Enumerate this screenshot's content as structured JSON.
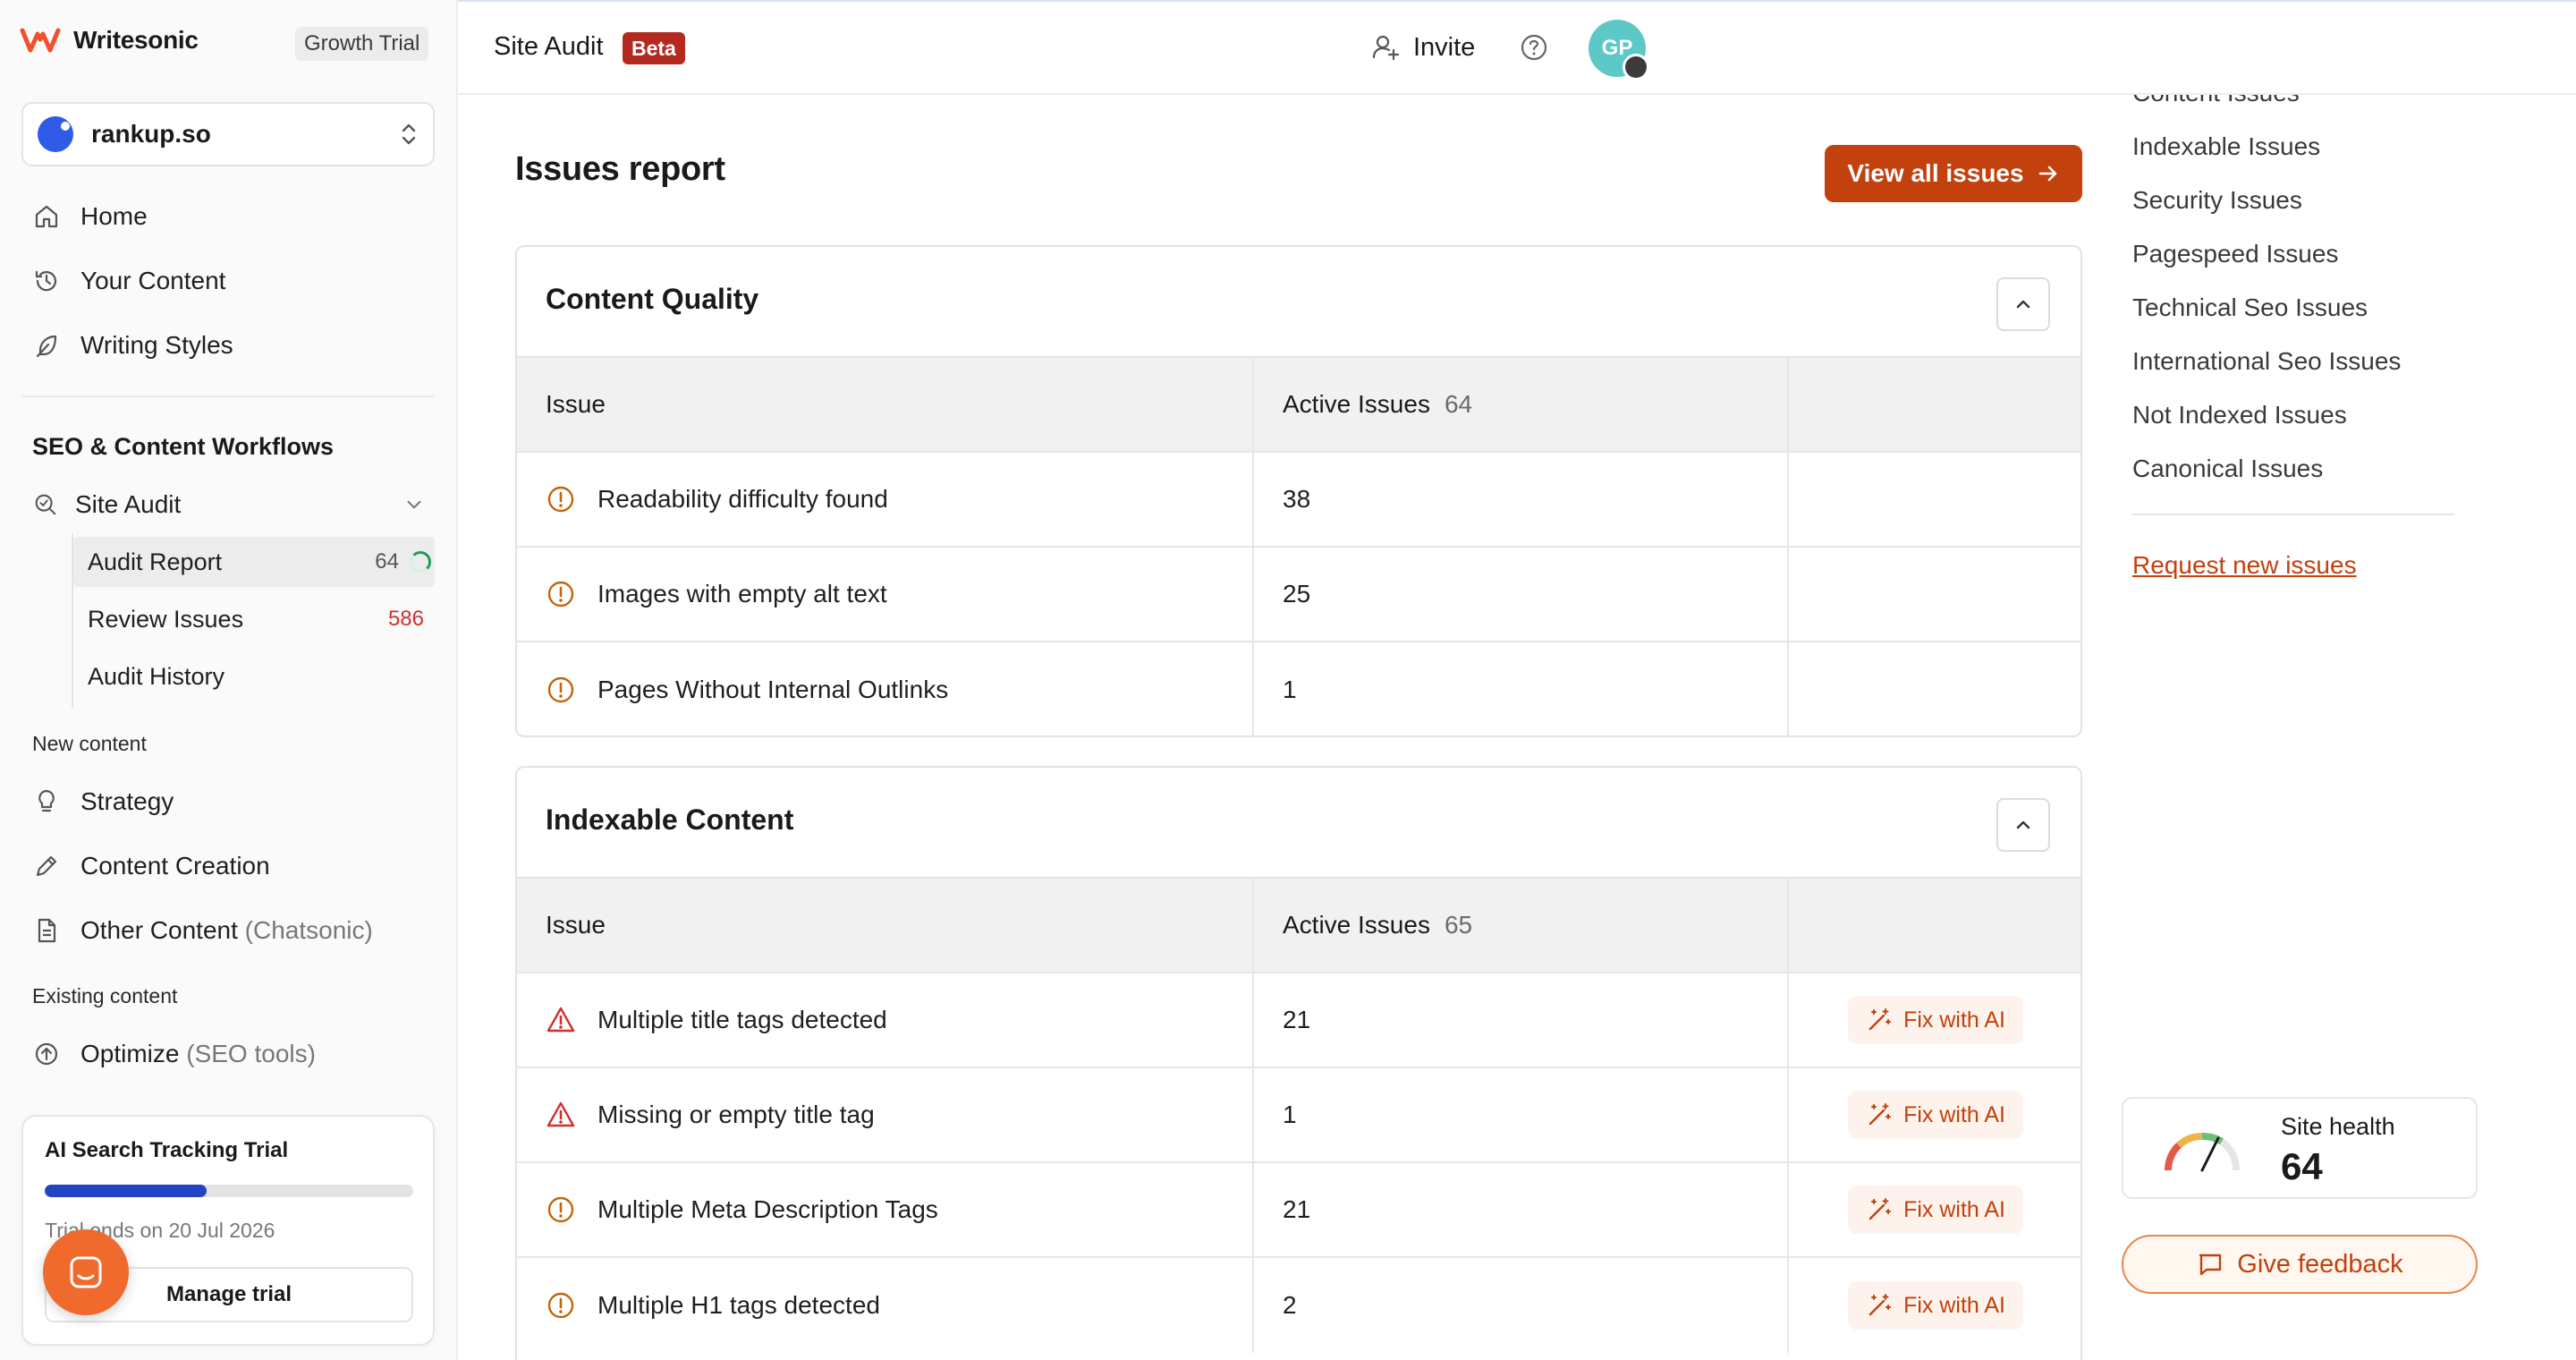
{
  "brand": {
    "name": "Writesonic",
    "plan_badge": "Growth Trial"
  },
  "workspace": {
    "name": "rankup.so"
  },
  "nav": {
    "primary": [
      {
        "label": "Home",
        "icon": "home-icon"
      },
      {
        "label": "Your Content",
        "icon": "history-icon"
      },
      {
        "label": "Writing Styles",
        "icon": "feather-icon"
      }
    ],
    "seo_section_title": "SEO & Content Workflows",
    "site_audit_label": "Site Audit",
    "site_audit_sub": [
      {
        "label": "Audit Report",
        "count": "64"
      },
      {
        "label": "Review Issues",
        "count": "586"
      },
      {
        "label": "Audit History"
      }
    ],
    "new_content_label": "New content",
    "new_content": [
      {
        "label": "Strategy"
      },
      {
        "label": "Content Creation"
      },
      {
        "label": "Other Content",
        "suffix": "(Chatsonic)"
      }
    ],
    "existing_content_label": "Existing content",
    "existing_content": [
      {
        "label": "Optimize",
        "suffix": "(SEO tools)"
      }
    ]
  },
  "trial": {
    "title": "AI Search Tracking Trial",
    "progress": 0.44,
    "ends": "Trial ends on 20 Jul 2026",
    "manage_label": "Manage trial"
  },
  "header": {
    "title": "Site Audit",
    "badge": "Beta",
    "invite_label": "Invite",
    "avatar_initials": "GP"
  },
  "main": {
    "title": "Issues report",
    "view_all_label": "View all issues",
    "col_issue": "Issue",
    "col_active": "Active Issues",
    "fix_label": "Fix with AI",
    "sections": [
      {
        "title": "Content Quality",
        "active_total": "64",
        "rows": [
          {
            "label": "Readability difficulty found",
            "count": "38",
            "severity": "warning"
          },
          {
            "label": "Images with empty alt text",
            "count": "25",
            "severity": "warning"
          },
          {
            "label": "Pages Without Internal Outlinks",
            "count": "1",
            "severity": "warning"
          }
        ]
      },
      {
        "title": "Indexable Content",
        "active_total": "65",
        "rows": [
          {
            "label": "Multiple title tags detected",
            "count": "21",
            "severity": "error"
          },
          {
            "label": "Missing or empty title tag",
            "count": "1",
            "severity": "error"
          },
          {
            "label": "Multiple Meta Description Tags",
            "count": "21",
            "severity": "warning"
          },
          {
            "label": "Multiple H1 tags detected",
            "count": "2",
            "severity": "warning"
          }
        ]
      }
    ]
  },
  "toc": {
    "items": [
      "Content Issues",
      "Indexable Issues",
      "Security Issues",
      "Pagespeed Issues",
      "Technical Seo Issues",
      "International Seo Issues",
      "Not Indexed Issues",
      "Canonical Issues"
    ],
    "request_label": "Request new issues"
  },
  "health": {
    "label": "Site health",
    "value": "64"
  },
  "feedback": {
    "label": "Give feedback"
  },
  "colors": {
    "accent": "#c2410c",
    "warning": "#c2650c",
    "error": "#d12f2f",
    "beta": "#b42a1e"
  }
}
